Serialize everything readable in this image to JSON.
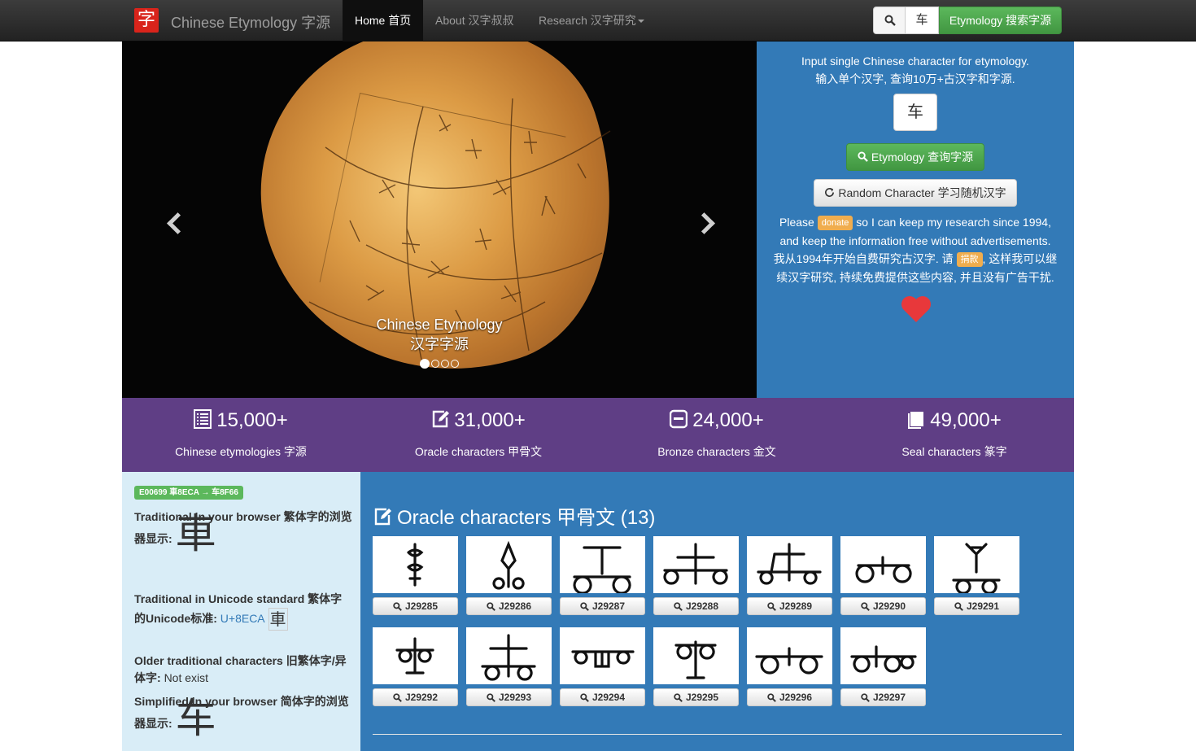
{
  "navbar": {
    "logo_char": "字",
    "brand": "Chinese Etymology 字源",
    "home": "Home 首页",
    "about": "About 汉字叔叔",
    "research": "Research 汉字研究",
    "search_value": "车",
    "etymology_button": "Etymology 搜索字源"
  },
  "carousel": {
    "caption_title": "Chinese Etymology",
    "caption_subtitle": "汉字字源",
    "slide_count": 4,
    "active_slide": 1
  },
  "search_panel": {
    "line1": "Input single Chinese character for etymology.",
    "line2": "输入单个汉字, 查询10万+古汉字和字源.",
    "input_value": "车",
    "etymology_button": "Etymology 查询字源",
    "random_button": "Random Character 学习随机汉字",
    "donate_pre": "Please",
    "donate_badge": "donate",
    "donate_post": "so I can keep my research since 1994,",
    "donate_line2": "and keep the information free without advertisements.",
    "donate_cn_pre": "我从1994年开始自费研究古汉字. 请",
    "donate_cn_badge": "捐款",
    "donate_cn_post": ", 这样我可以继",
    "donate_cn_line2": "续汉字研究, 持续免费提供这些内容, 并且没有广告干扰.",
    "heart_color": "#e8383b"
  },
  "stats": [
    {
      "icon": "list-icon",
      "number": "15,000+",
      "label": "Chinese etymologies 字源"
    },
    {
      "icon": "edit-icon",
      "number": "31,000+",
      "label": "Oracle characters 甲骨文"
    },
    {
      "icon": "bronze-icon",
      "number": "24,000+",
      "label": "Bronze characters 金文"
    },
    {
      "icon": "book-icon",
      "number": "49,000+",
      "label": "Seal characters 篆字"
    }
  ],
  "info": {
    "badge": "E00699 車8ECA → 车8F66",
    "trad_browser_label": "Traditional in your browser 繁体字的浏览器显示:",
    "trad_browser_char": "車",
    "trad_unicode_label": "Traditional in Unicode standard 繁体字的Unicode标准:",
    "trad_unicode_code": "U+8ECA",
    "trad_unicode_char": "車",
    "older_label": "Older traditional characters 旧繁体字/异体字:",
    "older_value": "Not exist",
    "simp_label": "Simplified in your browser 简体字的浏览器显示:",
    "simp_char": "车"
  },
  "oracle": {
    "title": "Oracle characters 甲骨文 (13)",
    "items": [
      "J29285",
      "J29286",
      "J29287",
      "J29288",
      "J29289",
      "J29290",
      "J29291",
      "J29292",
      "J29293",
      "J29294",
      "J29295",
      "J29296",
      "J29297"
    ]
  },
  "colors": {
    "navbar": "#222222",
    "panel_blue": "#337ab7",
    "stats_purple": "#5f3e85",
    "info_bg": "#d9edf7",
    "success_green": "#5cb85c",
    "warning_orange": "#f0ad4e"
  }
}
